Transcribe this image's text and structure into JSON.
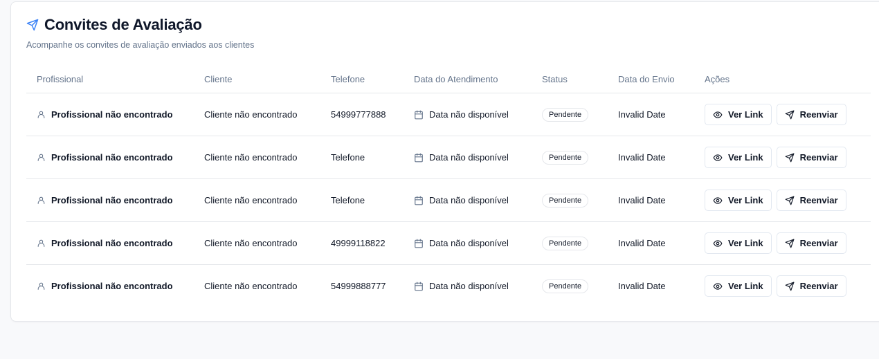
{
  "header": {
    "title": "Convites de Avaliação",
    "subtitle": "Acompanhe os convites de avaliação enviados aos clientes",
    "title_icon": "send-icon",
    "accent_color": "#3b82f6"
  },
  "table": {
    "columns": [
      "Profissional",
      "Cliente",
      "Telefone",
      "Data do Atendimento",
      "Status",
      "Data do Envio",
      "Ações"
    ],
    "rows": [
      {
        "profissional": "Profissional não encontrado",
        "cliente": "Cliente não encontrado",
        "telefone": "54999777888",
        "data_atendimento": "Data não disponível",
        "status": "Pendente",
        "data_envio": "Invalid Date"
      },
      {
        "profissional": "Profissional não encontrado",
        "cliente": "Cliente não encontrado",
        "telefone": "Telefone",
        "data_atendimento": "Data não disponível",
        "status": "Pendente",
        "data_envio": "Invalid Date"
      },
      {
        "profissional": "Profissional não encontrado",
        "cliente": "Cliente não encontrado",
        "telefone": "Telefone",
        "data_atendimento": "Data não disponível",
        "status": "Pendente",
        "data_envio": "Invalid Date"
      },
      {
        "profissional": "Profissional não encontrado",
        "cliente": "Cliente não encontrado",
        "telefone": "49999118822",
        "data_atendimento": "Data não disponível",
        "status": "Pendente",
        "data_envio": "Invalid Date"
      },
      {
        "profissional": "Profissional não encontrado",
        "cliente": "Cliente não encontrado",
        "telefone": "54999888777",
        "data_atendimento": "Data não disponível",
        "status": "Pendente",
        "data_envio": "Invalid Date"
      }
    ]
  },
  "actions": {
    "view_label": "Ver Link",
    "view_icon": "eye-icon",
    "resend_label": "Reenviar",
    "resend_icon": "send-icon"
  }
}
